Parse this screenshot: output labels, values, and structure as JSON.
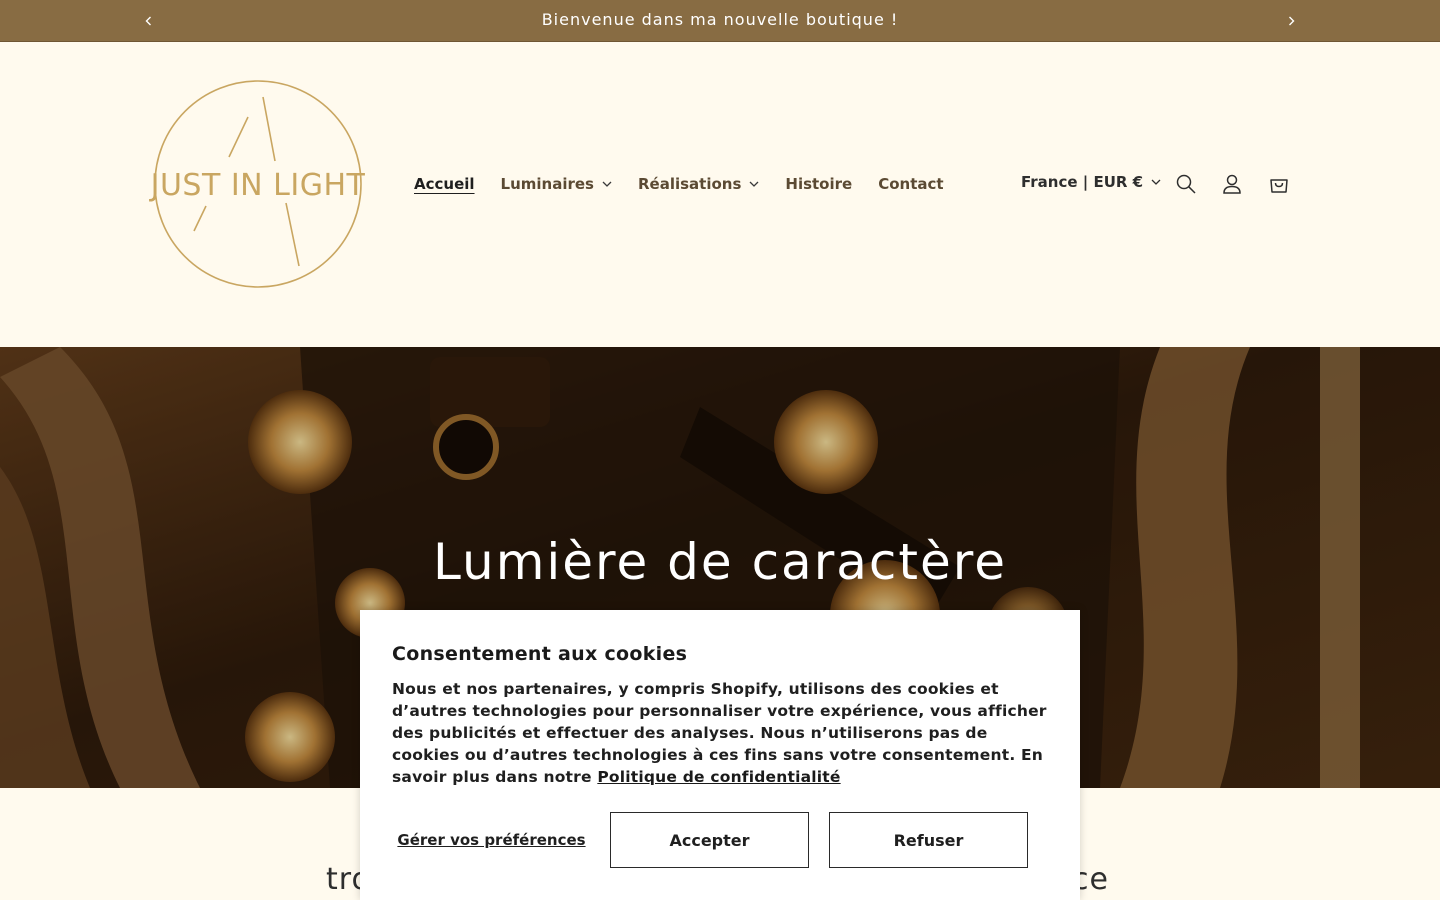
{
  "announcement": {
    "text": "Bienvenue dans ma nouvelle boutique !",
    "prev_icon": "chevron-left-icon",
    "next_icon": "chevron-right-icon",
    "background": "#886c43"
  },
  "logo": {
    "text": "JUST IN LIGHT",
    "color": "#c9a661"
  },
  "nav": {
    "items": [
      {
        "label": "Accueil",
        "active": true,
        "has_dropdown": false
      },
      {
        "label": "Luminaires",
        "active": false,
        "has_dropdown": true
      },
      {
        "label": "Réalisations",
        "active": false,
        "has_dropdown": true
      },
      {
        "label": "Histoire",
        "active": false,
        "has_dropdown": false
      },
      {
        "label": "Contact",
        "active": false,
        "has_dropdown": false
      }
    ]
  },
  "header_actions": {
    "country_label": "France | EUR €",
    "search_icon": "search-icon",
    "account_icon": "account-icon",
    "cart_icon": "cart-icon"
  },
  "hero": {
    "title": "Lumière de caractère"
  },
  "below": {
    "text_left": "tro",
    "text_right": "ce"
  },
  "cookie_banner": {
    "title": "Consentement aux cookies",
    "body": "Nous et nos partenaires, y compris Shopify, utilisons des cookies et d’autres technologies pour personnaliser votre expérience, vous afficher des publicités et effectuer des analyses. Nous n’utiliserons pas de cookies ou d’autres technologies à ces fins sans votre consentement. En savoir plus dans notre ",
    "policy_link": "Politique de confidentialité",
    "prefs_button": "Gérer vos préférences",
    "accept_button": "Accepter",
    "refuse_button": "Refuser"
  }
}
